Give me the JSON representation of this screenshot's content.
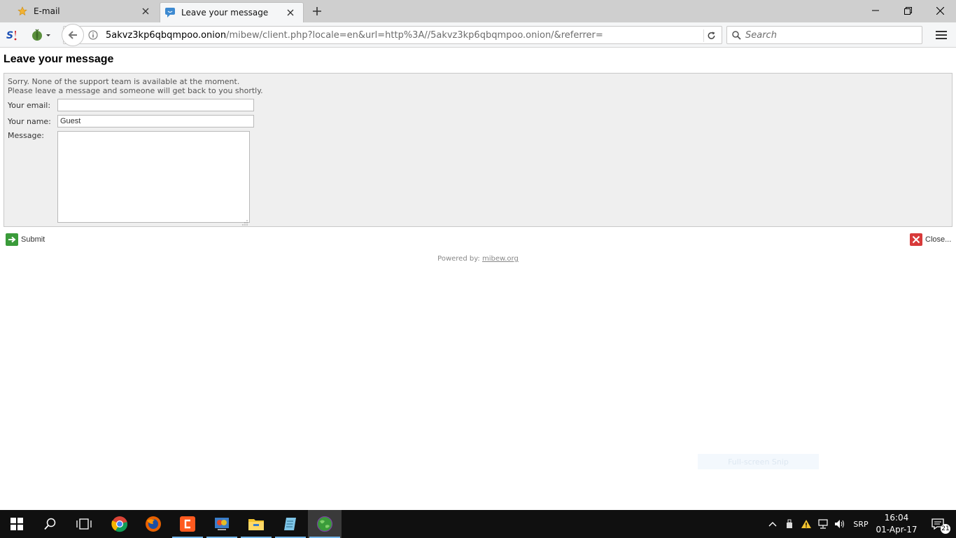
{
  "browser": {
    "tabs": [
      {
        "title": "E-mail",
        "favicon": "star-icon",
        "active": false
      },
      {
        "title": "Leave your message",
        "favicon": "chat-icon",
        "active": true
      }
    ],
    "url_host": "5akvz3kp6qbqmpoo.onion",
    "url_path": "/mibew/client.php?locale=en&url=http%3A//5akvz3kp6qbqmpoo.onion/&referrer=",
    "search_placeholder": "Search",
    "accent_color": "#76b9ed"
  },
  "page": {
    "title": "Leave your message",
    "notice_line1": "Sorry. None of the support team is available at the moment.",
    "notice_line2": "Please leave a message and someone will get back to you shortly.",
    "form": {
      "email_label": "Your email:",
      "email_value": "",
      "name_label": "Your name:",
      "name_value": "Guest",
      "message_label": "Message:",
      "message_value": ""
    },
    "submit_label": "Submit",
    "close_label": "Close...",
    "powered_by_prefix": "Powered by:",
    "powered_by_link": "mibew.org"
  },
  "overlay": {
    "snip_label": "Full-screen Snip"
  },
  "taskbar": {
    "language": "SRP",
    "time": "16:04",
    "date": "01-Apr-17",
    "notification_count": "21"
  }
}
